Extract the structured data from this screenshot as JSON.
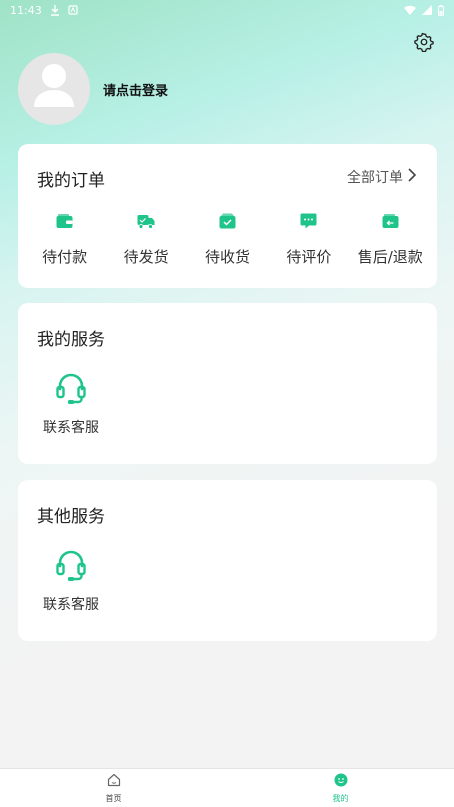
{
  "status_bar": {
    "time": "11:43",
    "icons": [
      "download-icon",
      "notification-icon",
      "wifi-icon",
      "signal-icon",
      "battery-icon"
    ]
  },
  "header": {
    "settings_icon": "gear-icon"
  },
  "profile": {
    "avatar_icon": "user-placeholder-icon",
    "login_prompt": "请点击登录"
  },
  "orders": {
    "title": "我的订单",
    "all_orders_label": "全部订单",
    "items": [
      {
        "label": "待付款",
        "icon": "wallet-icon"
      },
      {
        "label": "待发货",
        "icon": "truck-icon"
      },
      {
        "label": "待收货",
        "icon": "box-check-icon"
      },
      {
        "label": "待评价",
        "icon": "comment-icon"
      },
      {
        "label": "售后/退款",
        "icon": "refund-icon"
      }
    ]
  },
  "my_services": {
    "title": "我的服务",
    "items": [
      {
        "label": "联系客服",
        "icon": "headset-icon"
      }
    ]
  },
  "other_services": {
    "title": "其他服务",
    "items": [
      {
        "label": "联系客服",
        "icon": "headset-icon"
      }
    ]
  },
  "tabbar": {
    "tabs": [
      {
        "label": "首页",
        "icon": "home-icon",
        "active": false
      },
      {
        "label": "我的",
        "icon": "profile-smile-icon",
        "active": true
      }
    ]
  },
  "colors": {
    "accent": "#1fc48a",
    "background": "#f3f3f3",
    "card": "#ffffff"
  }
}
